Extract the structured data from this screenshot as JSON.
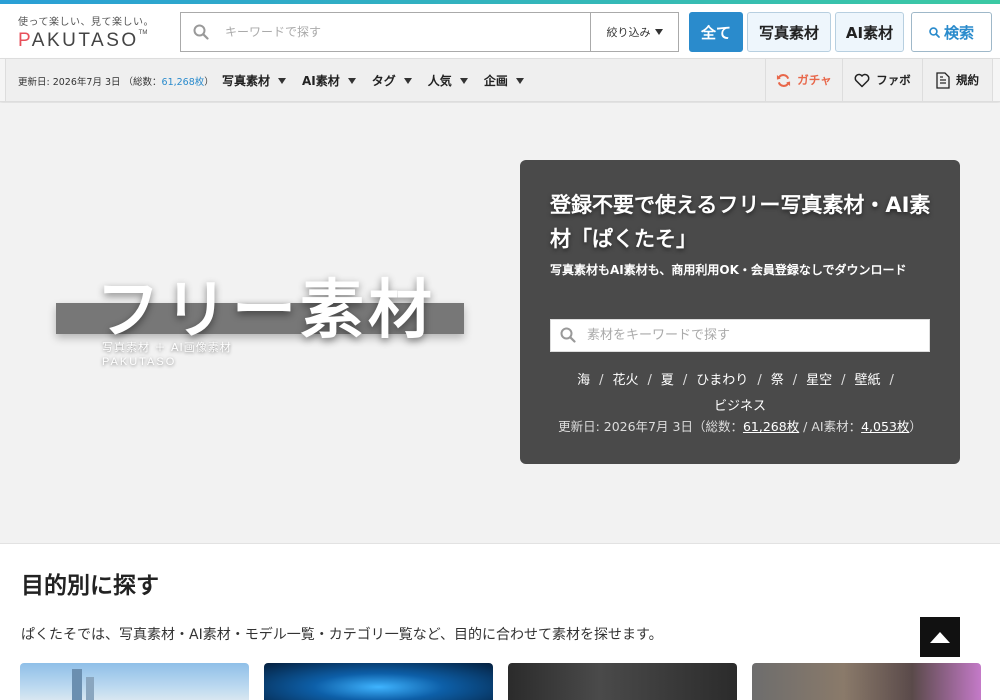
{
  "header": {
    "logo": {
      "tagline": "使って楽しい、見て楽しい。",
      "wordmark": "PAKUTASO"
    },
    "search": {
      "placeholder": "キーワードで探す",
      "value": ""
    },
    "filter_label": "絞り込み",
    "type_buttons": {
      "all": "全て",
      "photo": "写真素材",
      "ai": "AI素材"
    },
    "search_button": "検索"
  },
  "subnav": {
    "update_prefix": "更新日: 2026年7月 3日 （総数：",
    "update_count": "61,268枚",
    "update_suffix": "）",
    "menu": [
      {
        "label": "写真素材"
      },
      {
        "label": "AI素材"
      },
      {
        "label": "タグ"
      },
      {
        "label": "人気"
      },
      {
        "label": "企画"
      }
    ],
    "gacha": "ガチャ",
    "favorites": "ファボ",
    "rules": "規約"
  },
  "hero": {
    "title": "フリー素材",
    "subtitle": "写真素材 ＋ AI画像素材",
    "brand": "PAKUTASO",
    "card": {
      "title": "登録不要で使えるフリー写真素材・AI素材「ぱくたそ」",
      "description": "写真素材もAI素材も、商用利用OK・会員登録なしでダウンロード",
      "search_placeholder": "素材をキーワードで探す",
      "tags": [
        "海",
        "花火",
        "夏",
        "ひまわり",
        "祭",
        "星空",
        "壁紙",
        "ビジネス"
      ],
      "update_prefix": "更新日: 2026年7月 3日（総数：",
      "total_count": "61,268枚",
      "ai_label": " / AI素材：",
      "ai_count": "4,053枚",
      "update_suffix": "）"
    }
  },
  "purpose": {
    "title": "目的別に探す",
    "description": "ぱくたそでは、写真素材・AI素材・モデル一覧・カテゴリ一覧など、目的に合わせて素材を探せます。"
  },
  "colors": {
    "accent_blue": "#2a8bcc",
    "gacha_orange": "#e8674a",
    "card_bg": "#4a4a4a"
  },
  "icons": {
    "search": "search-icon",
    "gacha": "refresh-icon",
    "favorites": "heart-icon",
    "rules": "document-icon",
    "back_to_top": "arrow-up-icon"
  }
}
